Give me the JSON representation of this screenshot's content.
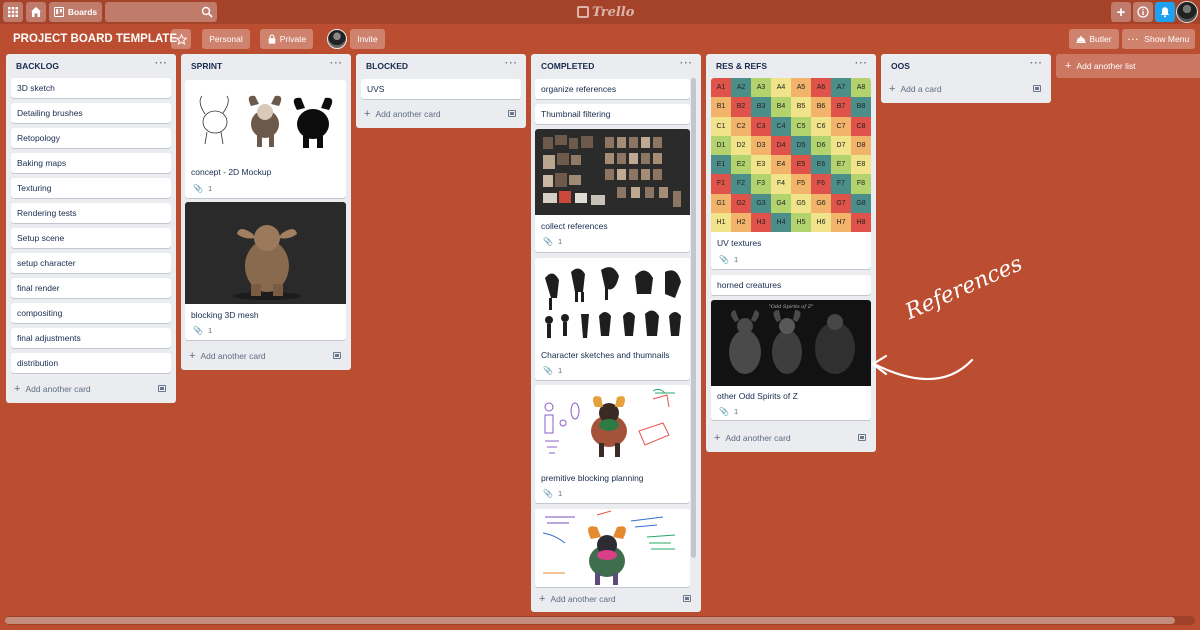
{
  "header": {
    "boards_label": "Boards",
    "search_value": "",
    "logo_text": "Trello"
  },
  "board": {
    "title": "PROJECT BOARD TEMPLATE",
    "team_label": "Personal",
    "visibility_label": "Private",
    "invite_label": "Invite",
    "butler_label": "Butler",
    "menu_label": "Show Menu"
  },
  "lists": {
    "backlog": {
      "title": "BACKLOG",
      "cards": [
        "3D sketch",
        "Detailing brushes",
        "Retopology",
        "Baking maps",
        "Texturing",
        "Rendering tests",
        "Setup scene",
        "setup character",
        "final render",
        "compositing",
        "final adjustments",
        "distribution"
      ],
      "add_label": "Add another card"
    },
    "sprint": {
      "title": "SPRINT",
      "cards": [
        {
          "title": "concept - 2D Mockup",
          "attachments": "1"
        },
        {
          "title": "blocking 3D mesh",
          "attachments": "1"
        }
      ],
      "add_label": "Add another card"
    },
    "blocked": {
      "title": "BLOCKED",
      "cards": [
        "UVS"
      ],
      "add_label": "Add another card"
    },
    "completed": {
      "title": "COMPLETED",
      "cards": [
        {
          "title": "organize references"
        },
        {
          "title": "Thumbnail filtering"
        },
        {
          "title": "collect references",
          "attachments": "1"
        },
        {
          "title": "Character sketches and thumnails",
          "attachments": "1"
        },
        {
          "title": "premitive blocking planning",
          "attachments": "1"
        }
      ],
      "add_label": "Add another card"
    },
    "res_refs": {
      "title": "RES & REFS",
      "cards": [
        {
          "title": "UV textures",
          "attachments": "1"
        },
        {
          "title": "horned creatures"
        },
        {
          "title": "other Odd Spirits of Z",
          "attachments": "1"
        }
      ],
      "cover_caption": "\"Odd Spirits of Z\"",
      "add_label": "Add another card"
    },
    "oos": {
      "title": "OOS",
      "add_label": "Add a card"
    },
    "add_list_label": "Add another list"
  },
  "uv_grid": {
    "rows": [
      "A",
      "B",
      "C",
      "D",
      "E",
      "F",
      "G",
      "H"
    ],
    "cols": [
      "1",
      "2",
      "3",
      "4",
      "5",
      "6",
      "7",
      "8"
    ],
    "colors": [
      "#e0534a",
      "#f0e38a",
      "#4c8f8a",
      "#f2b36b",
      "#b3d36f"
    ]
  },
  "annotation": {
    "text": "References"
  },
  "colors": {
    "board_bg": "#bb4d30",
    "header_bg": "#a5432a",
    "notification": "#1da1f2"
  }
}
